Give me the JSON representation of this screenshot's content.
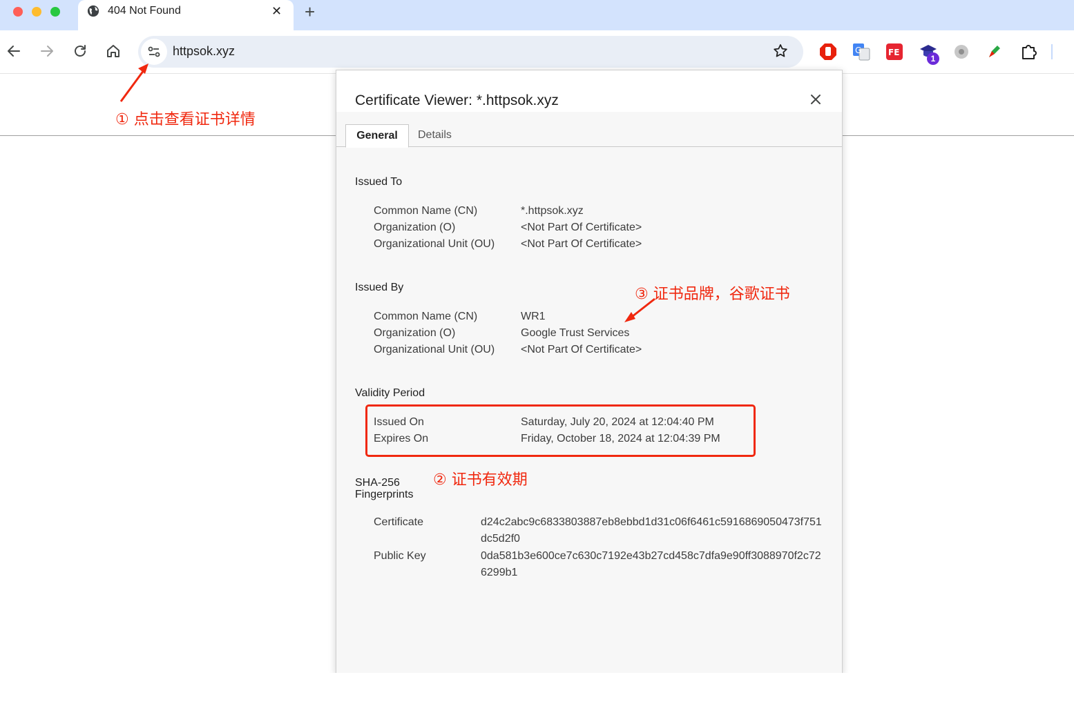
{
  "window": {
    "tab_title": "404 Not Found",
    "tab_close": "✕",
    "new_tab": "+"
  },
  "toolbar": {
    "url": "httpsok.xyz",
    "extensions": [
      "stop-sign-icon",
      "translate-icon",
      "fe-helper-icon",
      "graduation-cap-icon",
      "gray-flower-icon",
      "colorful-pen-icon",
      "puzzle-piece-icon"
    ],
    "ext_badge": "1"
  },
  "dialog": {
    "title": "Certificate Viewer: *.httpsok.xyz",
    "tabs": [
      {
        "label": "General",
        "active": true
      },
      {
        "label": "Details",
        "active": false
      }
    ],
    "issued_to": {
      "heading": "Issued To",
      "rows": [
        {
          "label": "Common Name (CN)",
          "value": "*.httpsok.xyz"
        },
        {
          "label": "Organization (O)",
          "value": "<Not Part Of Certificate>"
        },
        {
          "label": "Organizational Unit (OU)",
          "value": "<Not Part Of Certificate>"
        }
      ]
    },
    "issued_by": {
      "heading": "Issued By",
      "rows": [
        {
          "label": "Common Name (CN)",
          "value": "WR1"
        },
        {
          "label": "Organization (O)",
          "value": "Google Trust Services"
        },
        {
          "label": "Organizational Unit (OU)",
          "value": "<Not Part Of Certificate>"
        }
      ]
    },
    "validity": {
      "heading": "Validity Period",
      "rows": [
        {
          "label": "Issued On",
          "value": "Saturday, July 20, 2024 at 12:04:40 PM"
        },
        {
          "label": "Expires On",
          "value": "Friday, October 18, 2024 at 12:04:39 PM"
        }
      ]
    },
    "fingerprints": {
      "heading": "SHA-256 Fingerprints",
      "rows": [
        {
          "label": "Certificate",
          "value": "d24c2abc9c6833803887eb8ebbd1d31c06f6461c5916869050473f751dc5d2f0"
        },
        {
          "label": "Public Key",
          "value": "0da581b3e600ce7c630c7192e43b27cd458c7dfa9e90ff3088970f2c726299b1"
        }
      ]
    }
  },
  "annotations": {
    "step1": "① 点击查看证书详情",
    "step2": "② 证书有效期",
    "step3": "③ 证书品牌，谷歌证书",
    "color": "#f0280f"
  },
  "colors": {
    "tabstrip": "#d3e3fd",
    "omnibox": "#e9eef6",
    "dialog_bg": "#f7f7f7"
  }
}
